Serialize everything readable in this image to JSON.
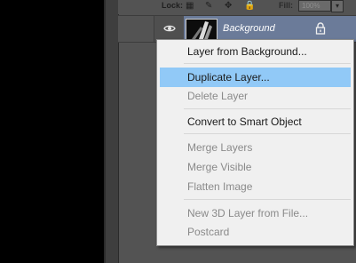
{
  "layers_panel": {
    "lock_label": "Lock:",
    "fill_label": "Fill:",
    "fill_value": "100%",
    "layer": {
      "name": "Background",
      "visible": true,
      "locked": true
    }
  },
  "context_menu": {
    "items": [
      {
        "label": "Layer from Background...",
        "enabled": true
      },
      {
        "label": "Duplicate Layer...",
        "enabled": true,
        "highlighted": true
      },
      {
        "label": "Delete Layer",
        "enabled": false
      },
      {
        "label": "Convert to Smart Object",
        "enabled": true
      },
      {
        "label": "Merge Layers",
        "enabled": false
      },
      {
        "label": "Merge Visible",
        "enabled": false
      },
      {
        "label": "Flatten Image",
        "enabled": false
      },
      {
        "label": "New 3D Layer from File...",
        "enabled": false
      },
      {
        "label": "Postcard",
        "enabled": false
      }
    ]
  },
  "colors": {
    "menu_highlight": "#91c9f7",
    "selected_layer": "#6b7b99",
    "panel_bg": "#535353"
  }
}
